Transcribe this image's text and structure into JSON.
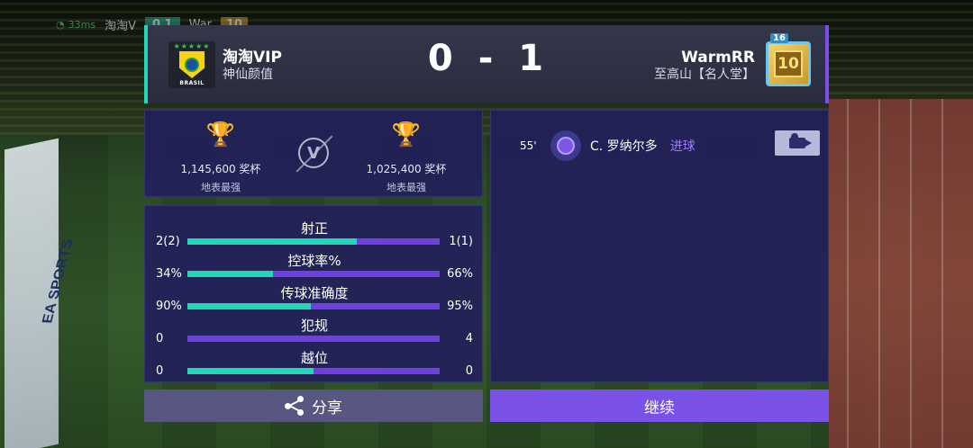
{
  "hud": {
    "ping": "33ms",
    "home_short": "淘淘V",
    "score": "0  1",
    "away_short": "War",
    "level": "10"
  },
  "header": {
    "home": {
      "name": "淘淘VIP",
      "subtitle": "神仙颜值",
      "logo_caption": "BRASIL"
    },
    "score_home": "0",
    "score_sep": "-",
    "score_away": "1",
    "away": {
      "name": "WarmRR",
      "subtitle": "至高山【名人堂】",
      "badge_level": "10",
      "badge_tier": "16"
    },
    "colors": {
      "home_accent": "#22d6b8",
      "away_accent": "#7c4ef0"
    }
  },
  "trophies": {
    "home": {
      "value": "1,145,600 奖杯",
      "label": "地表最强"
    },
    "vs": "V",
    "away": {
      "value": "1,025,400 奖杯",
      "label": "地表最强"
    }
  },
  "stats": [
    {
      "label": "射正",
      "home": "2(2)",
      "away": "1(1)",
      "home_share": 0.67
    },
    {
      "label": "控球率%",
      "home": "34%",
      "away": "66%",
      "home_share": 0.34
    },
    {
      "label": "传球准确度",
      "home": "90%",
      "away": "95%",
      "home_share": 0.49
    },
    {
      "label": "犯规",
      "home": "0",
      "away": "4",
      "home_share": 0.0
    },
    {
      "label": "越位",
      "home": "0",
      "away": "0",
      "home_share": 0.5
    }
  ],
  "events": [
    {
      "minute": "55'",
      "player": "C. 罗纳尔多",
      "type": "进球",
      "icon": "soccer-ball-icon"
    }
  ],
  "buttons": {
    "share": "分享",
    "continue": "继续"
  },
  "background": {
    "adboard_text": "EA SPORTS"
  }
}
